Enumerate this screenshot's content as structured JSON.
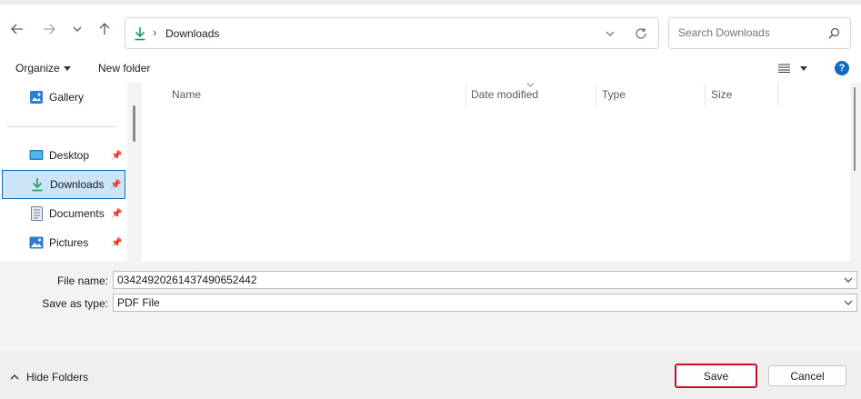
{
  "nav": {
    "breadcrumb_sep": "›",
    "current_folder": "Downloads",
    "search_placeholder": "Search Downloads"
  },
  "toolbar": {
    "organize_label": "Organize",
    "new_folder_label": "New folder",
    "help_label": "?"
  },
  "sidebar": {
    "items": [
      {
        "label": "Gallery",
        "icon": "gallery-icon",
        "pinned": false
      },
      {
        "label": "Desktop",
        "icon": "desktop-icon",
        "pinned": true
      },
      {
        "label": "Downloads",
        "icon": "download-icon",
        "pinned": true,
        "selected": true
      },
      {
        "label": "Documents",
        "icon": "documents-icon",
        "pinned": true
      },
      {
        "label": "Pictures",
        "icon": "pictures-icon",
        "pinned": true
      }
    ]
  },
  "columns": [
    "Name",
    "Date modified",
    "Type",
    "Size"
  ],
  "form": {
    "file_name_label": "File name:",
    "file_name_value": "03424920261437490652442",
    "save_type_label": "Save as type:",
    "save_type_value": "PDF File"
  },
  "footer": {
    "hide_folders_label": "Hide Folders",
    "save_label": "Save",
    "cancel_label": "Cancel"
  },
  "colors": {
    "accent": "#0f6cbd",
    "download_green": "#1a9b6b",
    "save_highlight": "#c40e2a",
    "selection_bg": "#cce4f7"
  }
}
